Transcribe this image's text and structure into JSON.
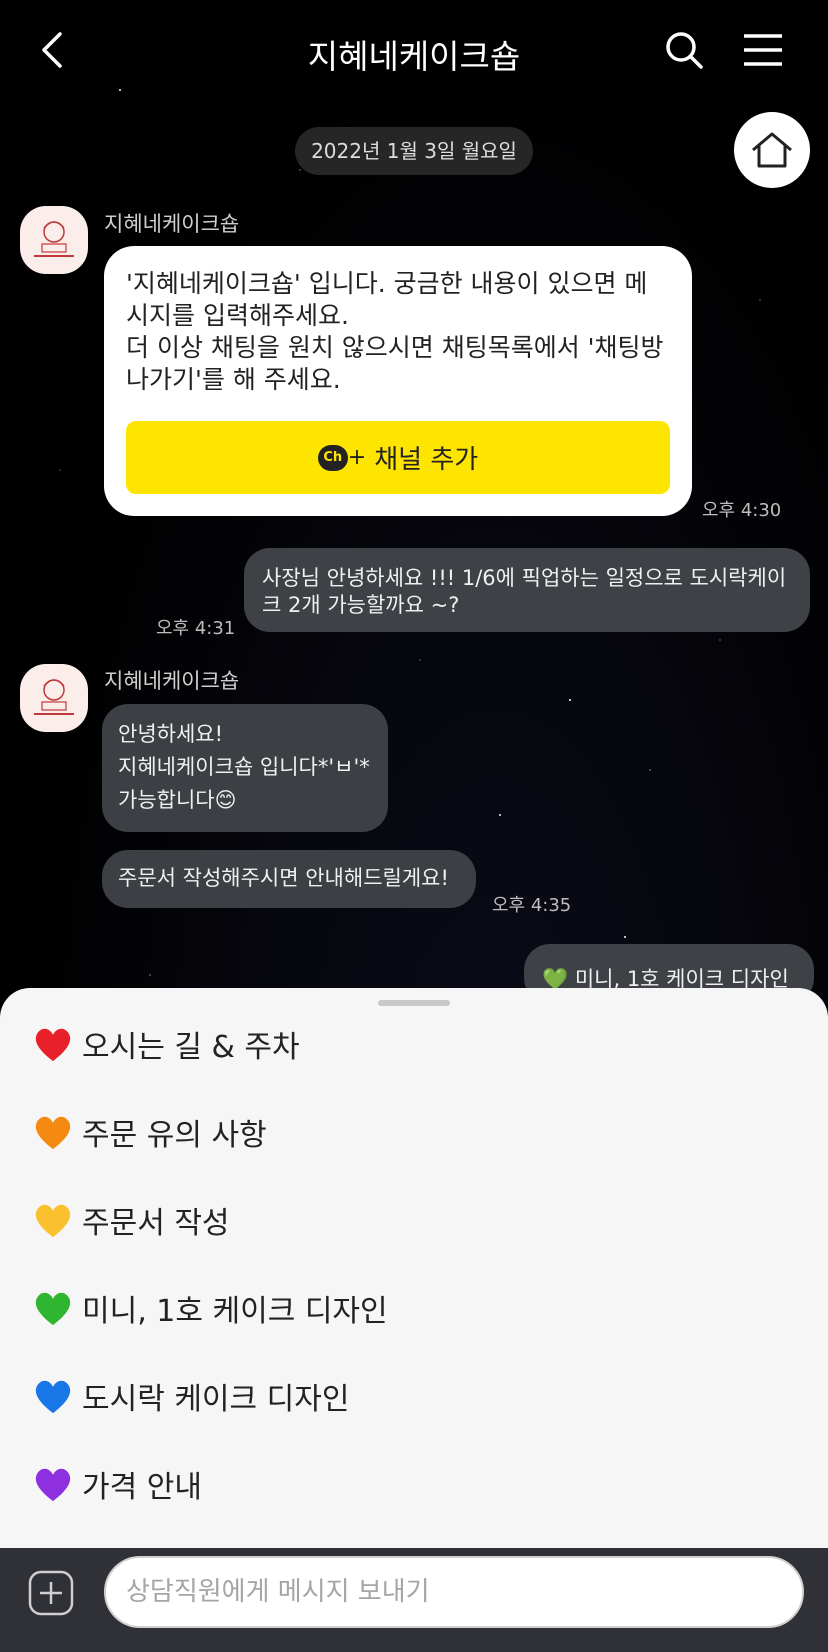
{
  "header": {
    "title": "지혜네케이크숍",
    "icons": [
      "back-icon",
      "search-icon",
      "menu-icon",
      "home-icon"
    ]
  },
  "date_divider": "2022년 1월 3일 월요일",
  "messages": {
    "sender_name": "지혜네케이크숍",
    "welcome_text": "'지혜네케이크숍' 입니다.  궁금한 내용이 있으면 메시지를 입력해주세요.\n더 이상 채팅을 원치 않으시면 채팅목록에서 '채팅방 나가기'를 해 주세요.",
    "channel_button": "채널 추가",
    "channel_icon_text": "Ch",
    "time_1": "오후 4:30",
    "user_message": "사장님 안녕하세요 !!! 1/6에 픽업하는 일정으로 도시락케이크 2개 가능할까요 ~?",
    "time_2": "오후 4:31",
    "reply_line1": "안녕하세요!",
    "reply_line2": "지혜네케이크숍 입니다*'ㅂ'*",
    "reply_line3": "가능합니다😊",
    "reply_2": "주문서 작성해주시면 안내해드릴게요!",
    "time_3": "오후 4:35",
    "partial_message": "💚 미니, 1호 케이크 디자인"
  },
  "quick_menu": {
    "items": [
      {
        "label": "오시는 길 & 주차",
        "color": "#e8202a"
      },
      {
        "label": "주문 유의 사항",
        "color": "#f58a12"
      },
      {
        "label": "주문서 작성",
        "color": "#fbc02d"
      },
      {
        "label": "미니, 1호 케이크 디자인",
        "color": "#2fb52f"
      },
      {
        "label": "도시락 케이크 디자인",
        "color": "#1976e6"
      },
      {
        "label": "가격 안내",
        "color": "#8e2fe0"
      }
    ]
  },
  "composer": {
    "placeholder": "상담직원에게 메시지 보내기"
  },
  "colors": {
    "channel_yellow": "#fee500",
    "bubble_dark": "#3c3f44",
    "sheet_bg": "#f6f6f6"
  }
}
